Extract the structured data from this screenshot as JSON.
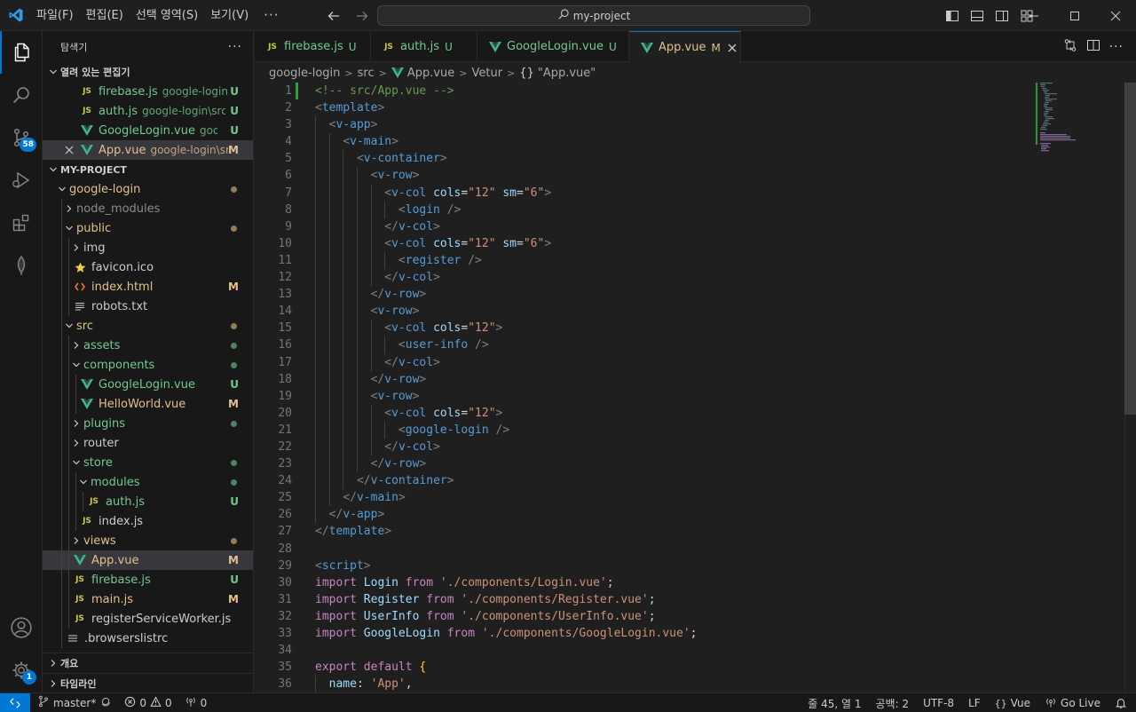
{
  "titlebar": {
    "menus": [
      "파일(F)",
      "편집(E)",
      "선택 영역(S)",
      "보기(V)"
    ],
    "more": "···",
    "search": "my-project"
  },
  "activitybar": {
    "scm_badge": "58",
    "settings_badge": "1"
  },
  "sidebar": {
    "title": "탐색기",
    "more": "···",
    "open_editors_title": "열려 있는 편집기",
    "open_editors": [
      {
        "name": "firebase.js",
        "desc": "google-login\\src",
        "status": "U",
        "icon": "js"
      },
      {
        "name": "auth.js",
        "desc": "google-login\\src\\store\\modules",
        "status": "U",
        "icon": "js"
      },
      {
        "name": "GoogleLogin.vue",
        "desc": "google-login\\src\\components",
        "status": "U",
        "icon": "vue"
      },
      {
        "name": "App.vue",
        "desc": "google-login\\src",
        "status": "M",
        "icon": "vue"
      }
    ],
    "project_title": "MY-PROJECT",
    "tree": [
      {
        "name": "google-login",
        "kind": "folder-open",
        "depth": 0,
        "color": "mod",
        "dot": true
      },
      {
        "name": "node_modules",
        "kind": "folder",
        "depth": 1,
        "color": "dim"
      },
      {
        "name": "public",
        "kind": "folder-open",
        "depth": 1,
        "color": "mod",
        "dot": true
      },
      {
        "name": "img",
        "kind": "folder",
        "depth": 2,
        "color": "plain"
      },
      {
        "name": "favicon.ico",
        "kind": "star",
        "depth": 2,
        "color": "plain"
      },
      {
        "name": "index.html",
        "kind": "html",
        "depth": 2,
        "color": "mod",
        "status": "M"
      },
      {
        "name": "robots.txt",
        "kind": "txt",
        "depth": 2,
        "color": "plain"
      },
      {
        "name": "src",
        "kind": "folder-open",
        "depth": 1,
        "color": "mod",
        "dot": true
      },
      {
        "name": "assets",
        "kind": "folder",
        "depth": 2,
        "color": "green",
        "dot": true
      },
      {
        "name": "components",
        "kind": "folder-open",
        "depth": 2,
        "color": "green",
        "dot": true
      },
      {
        "name": "GoogleLogin.vue",
        "kind": "vue",
        "depth": 3,
        "color": "green",
        "status": "U"
      },
      {
        "name": "HelloWorld.vue",
        "kind": "vue",
        "depth": 3,
        "color": "mod",
        "status": "M"
      },
      {
        "name": "plugins",
        "kind": "folder",
        "depth": 2,
        "color": "green",
        "dot": true
      },
      {
        "name": "router",
        "kind": "folder",
        "depth": 2,
        "color": "plain"
      },
      {
        "name": "store",
        "kind": "folder-open",
        "depth": 2,
        "color": "green",
        "dot": true
      },
      {
        "name": "modules",
        "kind": "folder-open",
        "depth": 3,
        "color": "green",
        "dot": true
      },
      {
        "name": "auth.js",
        "kind": "js",
        "depth": 4,
        "color": "green",
        "status": "U"
      },
      {
        "name": "index.js",
        "kind": "js",
        "depth": 3,
        "color": "plain"
      },
      {
        "name": "views",
        "kind": "folder",
        "depth": 2,
        "color": "mod",
        "dot": true
      },
      {
        "name": "App.vue",
        "kind": "vue",
        "depth": 2,
        "color": "mod",
        "status": "M",
        "selected": true
      },
      {
        "name": "firebase.js",
        "kind": "js",
        "depth": 2,
        "color": "green",
        "status": "U"
      },
      {
        "name": "main.js",
        "kind": "js",
        "depth": 2,
        "color": "mod",
        "status": "M"
      },
      {
        "name": "registerServiceWorker.js",
        "kind": "js",
        "depth": 2,
        "color": "plain"
      },
      {
        "name": ".browserslistrc",
        "kind": "list",
        "depth": 1,
        "color": "plain"
      }
    ],
    "outline_title": "개요",
    "timeline_title": "타임라인"
  },
  "tabs": [
    {
      "name": "firebase.js",
      "status": "U",
      "icon": "js",
      "color": "green"
    },
    {
      "name": "auth.js",
      "status": "U",
      "icon": "js",
      "color": "green"
    },
    {
      "name": "GoogleLogin.vue",
      "status": "U",
      "icon": "vue",
      "color": "green"
    },
    {
      "name": "App.vue",
      "status": "M",
      "icon": "vue",
      "color": "mod",
      "active": true
    }
  ],
  "breadcrumb": {
    "parts": [
      "google-login",
      "src",
      "App.vue",
      "Vetur"
    ],
    "last": "\"App.vue\"",
    "braces": "{}"
  },
  "code": {
    "lines": [
      [
        [
          "c",
          "<!-- src/App.vue -->"
        ]
      ],
      [
        [
          "t",
          "<"
        ],
        [
          "tn",
          "template"
        ],
        [
          "t",
          ">"
        ]
      ],
      [
        [
          "i",
          "  "
        ],
        [
          "t",
          "<"
        ],
        [
          "tag",
          "v-app"
        ],
        [
          "t",
          ">"
        ]
      ],
      [
        [
          "i",
          "    "
        ],
        [
          "t",
          "<"
        ],
        [
          "tag",
          "v-main"
        ],
        [
          "t",
          ">"
        ]
      ],
      [
        [
          "i",
          "      "
        ],
        [
          "t",
          "<"
        ],
        [
          "tag",
          "v-container"
        ],
        [
          "t",
          ">"
        ]
      ],
      [
        [
          "i",
          "        "
        ],
        [
          "t",
          "<"
        ],
        [
          "tag",
          "v-row"
        ],
        [
          "t",
          ">"
        ]
      ],
      [
        [
          "i",
          "          "
        ],
        [
          "t",
          "<"
        ],
        [
          "tag",
          "v-col"
        ],
        [
          "d",
          " "
        ],
        [
          "a",
          "cols"
        ],
        [
          "d",
          "="
        ],
        [
          "s",
          "\"12\""
        ],
        [
          "d",
          " "
        ],
        [
          "a",
          "sm"
        ],
        [
          "d",
          "="
        ],
        [
          "s",
          "\"6\""
        ],
        [
          "t",
          ">"
        ]
      ],
      [
        [
          "i",
          "            "
        ],
        [
          "t",
          "<"
        ],
        [
          "tag",
          "login"
        ],
        [
          "d",
          " "
        ],
        [
          "t",
          "/>"
        ]
      ],
      [
        [
          "i",
          "          "
        ],
        [
          "t",
          "</"
        ],
        [
          "tag",
          "v-col"
        ],
        [
          "t",
          ">"
        ]
      ],
      [
        [
          "i",
          "          "
        ],
        [
          "t",
          "<"
        ],
        [
          "tag",
          "v-col"
        ],
        [
          "d",
          " "
        ],
        [
          "a",
          "cols"
        ],
        [
          "d",
          "="
        ],
        [
          "s",
          "\"12\""
        ],
        [
          "d",
          " "
        ],
        [
          "a",
          "sm"
        ],
        [
          "d",
          "="
        ],
        [
          "s",
          "\"6\""
        ],
        [
          "t",
          ">"
        ]
      ],
      [
        [
          "i",
          "            "
        ],
        [
          "t",
          "<"
        ],
        [
          "tag",
          "register"
        ],
        [
          "d",
          " "
        ],
        [
          "t",
          "/>"
        ]
      ],
      [
        [
          "i",
          "          "
        ],
        [
          "t",
          "</"
        ],
        [
          "tag",
          "v-col"
        ],
        [
          "t",
          ">"
        ]
      ],
      [
        [
          "i",
          "        "
        ],
        [
          "t",
          "</"
        ],
        [
          "tag",
          "v-row"
        ],
        [
          "t",
          ">"
        ]
      ],
      [
        [
          "i",
          "        "
        ],
        [
          "t",
          "<"
        ],
        [
          "tag",
          "v-row"
        ],
        [
          "t",
          ">"
        ]
      ],
      [
        [
          "i",
          "          "
        ],
        [
          "t",
          "<"
        ],
        [
          "tag",
          "v-col"
        ],
        [
          "d",
          " "
        ],
        [
          "a",
          "cols"
        ],
        [
          "d",
          "="
        ],
        [
          "s",
          "\"12\""
        ],
        [
          "t",
          ">"
        ]
      ],
      [
        [
          "i",
          "            "
        ],
        [
          "t",
          "<"
        ],
        [
          "tag",
          "user-info"
        ],
        [
          "d",
          " "
        ],
        [
          "t",
          "/>"
        ]
      ],
      [
        [
          "i",
          "          "
        ],
        [
          "t",
          "</"
        ],
        [
          "tag",
          "v-col"
        ],
        [
          "t",
          ">"
        ]
      ],
      [
        [
          "i",
          "        "
        ],
        [
          "t",
          "</"
        ],
        [
          "tag",
          "v-row"
        ],
        [
          "t",
          ">"
        ]
      ],
      [
        [
          "i",
          "        "
        ],
        [
          "t",
          "<"
        ],
        [
          "tag",
          "v-row"
        ],
        [
          "t",
          ">"
        ]
      ],
      [
        [
          "i",
          "          "
        ],
        [
          "t",
          "<"
        ],
        [
          "tag",
          "v-col"
        ],
        [
          "d",
          " "
        ],
        [
          "a",
          "cols"
        ],
        [
          "d",
          "="
        ],
        [
          "s",
          "\"12\""
        ],
        [
          "t",
          ">"
        ]
      ],
      [
        [
          "i",
          "            "
        ],
        [
          "t",
          "<"
        ],
        [
          "tag",
          "google-login"
        ],
        [
          "d",
          " "
        ],
        [
          "t",
          "/>"
        ]
      ],
      [
        [
          "i",
          "          "
        ],
        [
          "t",
          "</"
        ],
        [
          "tag",
          "v-col"
        ],
        [
          "t",
          ">"
        ]
      ],
      [
        [
          "i",
          "        "
        ],
        [
          "t",
          "</"
        ],
        [
          "tag",
          "v-row"
        ],
        [
          "t",
          ">"
        ]
      ],
      [
        [
          "i",
          "      "
        ],
        [
          "t",
          "</"
        ],
        [
          "tag",
          "v-container"
        ],
        [
          "t",
          ">"
        ]
      ],
      [
        [
          "i",
          "    "
        ],
        [
          "t",
          "</"
        ],
        [
          "tag",
          "v-main"
        ],
        [
          "t",
          ">"
        ]
      ],
      [
        [
          "i",
          "  "
        ],
        [
          "t",
          "</"
        ],
        [
          "tag",
          "v-app"
        ],
        [
          "t",
          ">"
        ]
      ],
      [
        [
          "t",
          "</"
        ],
        [
          "tn",
          "template"
        ],
        [
          "t",
          ">"
        ]
      ],
      [],
      [
        [
          "t",
          "<"
        ],
        [
          "tn",
          "script"
        ],
        [
          "t",
          ">"
        ]
      ],
      [
        [
          "k",
          "import"
        ],
        [
          "d",
          " "
        ],
        [
          "v",
          "Login"
        ],
        [
          "d",
          " "
        ],
        [
          "k",
          "from"
        ],
        [
          "d",
          " "
        ],
        [
          "s",
          "'./components/Login.vue'"
        ],
        [
          "d",
          ";"
        ]
      ],
      [
        [
          "k",
          "import"
        ],
        [
          "d",
          " "
        ],
        [
          "v",
          "Register"
        ],
        [
          "d",
          " "
        ],
        [
          "k",
          "from"
        ],
        [
          "d",
          " "
        ],
        [
          "s",
          "'./components/Register.vue'"
        ],
        [
          "d",
          ";"
        ]
      ],
      [
        [
          "k",
          "import"
        ],
        [
          "d",
          " "
        ],
        [
          "v",
          "UserInfo"
        ],
        [
          "d",
          " "
        ],
        [
          "k",
          "from"
        ],
        [
          "d",
          " "
        ],
        [
          "s",
          "'./components/UserInfo.vue'"
        ],
        [
          "d",
          ";"
        ]
      ],
      [
        [
          "k",
          "import"
        ],
        [
          "d",
          " "
        ],
        [
          "v",
          "GoogleLogin"
        ],
        [
          "d",
          " "
        ],
        [
          "k",
          "from"
        ],
        [
          "d",
          " "
        ],
        [
          "s",
          "'./components/GoogleLogin.vue'"
        ],
        [
          "d",
          ";"
        ]
      ],
      [],
      [
        [
          "k",
          "export"
        ],
        [
          "d",
          " "
        ],
        [
          "k",
          "default"
        ],
        [
          "d",
          " "
        ],
        [
          "b",
          "{"
        ]
      ],
      [
        [
          "i",
          "  "
        ],
        [
          "v",
          "name"
        ],
        [
          "d",
          ": "
        ],
        [
          "s",
          "'App'"
        ],
        [
          "d",
          ","
        ]
      ]
    ]
  },
  "status": {
    "branch": "master*",
    "errors": "0",
    "warnings": "0",
    "ports": "0",
    "position": "줄 45, 열 1",
    "spaces": "공백: 2",
    "encoding": "UTF-8",
    "eol": "LF",
    "language": "Vue",
    "golive": "Go Live"
  },
  "colors": {
    "accent": "#0078d4",
    "untracked": "#73c991",
    "modified": "#e2c08d",
    "vue": "#41b883",
    "js": "#cbcb41"
  }
}
